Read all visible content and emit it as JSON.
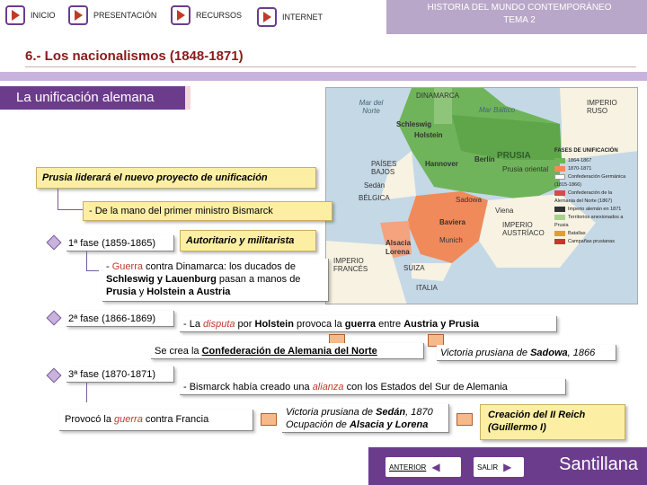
{
  "nav": {
    "inicio": "INICIO",
    "presentacion": "PRESENTACIÓN",
    "recursos": "RECURSOS",
    "internet": "INTERNET"
  },
  "header": {
    "title_line1": "HISTORIA DEL MUNDO CONTEMPORÁNEO",
    "title_line2": "TEMA 2"
  },
  "section_title": "6.- Los nacionalismos (1848-1871)",
  "subtitle": "La unificación alemana",
  "map": {
    "labels": {
      "mar_norte": "Mar del Norte",
      "dinamarca": "DINAMARCA",
      "mar_baltico": "Mar Báltico",
      "imperio_ruso": "IMPERIO RUSO",
      "schleswig": "Schleswig",
      "holstein": "Holstein",
      "paises_bajos": "PAÍSES BAJOS",
      "hannover": "Hannover",
      "prusia": "PRUSIA",
      "prusia_oriental": "Prusia oriental",
      "berlin": "Berlín",
      "belgica": "BÉLGICA",
      "sadowa": "Sadowa",
      "viena": "Viena",
      "baviera": "Baviera",
      "imperio_austriaco": "IMPERIO AUSTRÍACO",
      "munich": "Munich",
      "alsacia": "Alsacia",
      "lorena": "Lorena",
      "imperio_frances": "IMPERIO FRANCÉS",
      "suiza": "SUIZA",
      "italia": "ITALIA",
      "sedan": "Sedán"
    },
    "legend_title": "FASES DE UNIFICACIÓN",
    "legend": [
      {
        "label": "1864-1867",
        "color": "#6fb45a"
      },
      {
        "label": "1870-1871",
        "color": "#f08a5a"
      },
      {
        "label": "Confederación Germánica (1815-1866)",
        "color": "#ffffff"
      },
      {
        "label": "Confederación de la Alemania del Norte (1867)",
        "color": "#d94a4a"
      },
      {
        "label": "Imperio alemán en 1871",
        "color": "#333333"
      },
      {
        "label": "Territorios anexionados a Prusia",
        "color": "#a9d18e"
      },
      {
        "label": "Batallas",
        "color": "#e0a030"
      },
      {
        "label": "Campañas prusianas",
        "color": "#c0392b"
      }
    ]
  },
  "boxes": {
    "prusia_liderara": "Prusia liderará el nuevo proyecto de unificación",
    "bismarck": "- De la mano del primer ministro Bismarck",
    "fase1": "1ª fase (1859-1865)",
    "autoritario": "Autoritario y militarista",
    "guerra_dinamarca_1": "- ",
    "guerra_dinamarca_word": "Guerra",
    "guerra_dinamarca_2": " contra Dinamarca: ",
    "guerra_dinamarca_3": "los ducados de ",
    "guerra_dinamarca_4": "Schleswig y Lauenburg",
    "guerra_dinamarca_5": " pasan a manos de ",
    "guerra_dinamarca_6": "Prusia",
    "guerra_dinamarca_7": " y ",
    "guerra_dinamarca_8": "Holstein a Austria",
    "fase2": "2ª fase (1866-1869)",
    "disputa_1": "- La ",
    "disputa_word": "disputa",
    "disputa_2": " por ",
    "disputa_3": "Holstein",
    "disputa_4": " provoca la ",
    "disputa_5": "guerra",
    "disputa_6": " entre ",
    "disputa_7": "Austria y Prusia",
    "confed_1": "Se crea la ",
    "confed_2": "Confederación de Alemania del Norte",
    "sadowa_1": "Victoria prusiana de ",
    "sadowa_2": "Sadowa",
    "sadowa_3": ", 1866",
    "fase3": "3ª fase (1870-1871)",
    "alianza_1": "- Bismarck había creado una ",
    "alianza_word": "alianza",
    "alianza_2": " con los Estados del Sur de Alemania",
    "provoco_1": "Provocó la ",
    "provoco_word": "guerra",
    "provoco_2": " contra Francia",
    "sedan_1": "Victoria prusiana de ",
    "sedan_2": "Sedán",
    "sedan_3": ", 1870",
    "sedan_4": "Ocupación de ",
    "sedan_5": "Alsacia y Lorena",
    "reich": "Creación del II Reich (Guillermo I)"
  },
  "footer": {
    "anterior": "ANTERIOR",
    "salir": "SALIR",
    "brand": "Santillana"
  }
}
